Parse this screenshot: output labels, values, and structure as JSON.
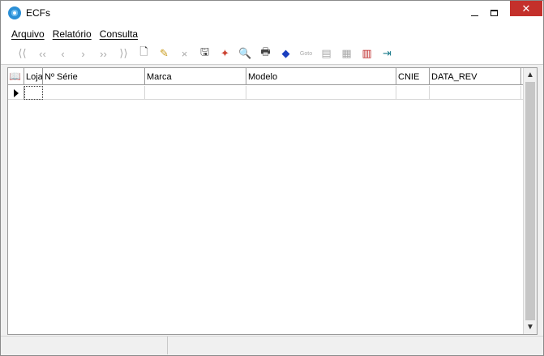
{
  "window": {
    "title": "ECFs",
    "accent": "#2b8fd6",
    "close_color": "#c4302b"
  },
  "menu": {
    "items": [
      {
        "label": "Arquivo"
      },
      {
        "label": "Relatório"
      },
      {
        "label": "Consulta"
      }
    ]
  },
  "toolbar": {
    "buttons": [
      {
        "icon": "first-record-icon",
        "glyph": "⟨⟨",
        "enabled": false
      },
      {
        "icon": "prior-page-icon",
        "glyph": "‹‹",
        "enabled": false
      },
      {
        "icon": "prior-record-icon",
        "glyph": "‹",
        "enabled": false
      },
      {
        "icon": "next-record-icon",
        "glyph": "›",
        "enabled": false
      },
      {
        "icon": "next-page-icon",
        "glyph": "››",
        "enabled": false
      },
      {
        "icon": "last-record-icon",
        "glyph": "⟩⟩",
        "enabled": false
      },
      {
        "icon": "new-document-icon",
        "glyph": "🗋",
        "enabled": true
      },
      {
        "icon": "edit-document-icon",
        "glyph": "✎",
        "enabled": true
      },
      {
        "icon": "delete-icon",
        "glyph": "×",
        "enabled": false
      },
      {
        "icon": "save-icon",
        "glyph": "🖫",
        "enabled": true
      },
      {
        "icon": "wand-icon",
        "glyph": "✦",
        "enabled": true
      },
      {
        "icon": "preview-icon",
        "glyph": "🔍",
        "enabled": true
      },
      {
        "icon": "print-icon",
        "glyph": "🖶",
        "enabled": true
      },
      {
        "icon": "eraser-icon",
        "glyph": "◆",
        "enabled": true
      },
      {
        "icon": "goto-icon",
        "glyph": "Goto",
        "enabled": false
      },
      {
        "icon": "filter-icon",
        "glyph": "▤",
        "enabled": false
      },
      {
        "icon": "settings-icon",
        "glyph": "▦",
        "enabled": false
      },
      {
        "icon": "export-icon",
        "glyph": "▥",
        "enabled": true
      },
      {
        "icon": "exit-icon",
        "glyph": "⇥",
        "enabled": true
      }
    ]
  },
  "grid": {
    "columns": [
      {
        "label": "Loja"
      },
      {
        "label": "Nº Série"
      },
      {
        "label": "Marca"
      },
      {
        "label": "Modelo"
      },
      {
        "label": "CNIE"
      },
      {
        "label": "DATA_REV"
      }
    ]
  },
  "status": {
    "panels": [
      "",
      "",
      ""
    ]
  }
}
